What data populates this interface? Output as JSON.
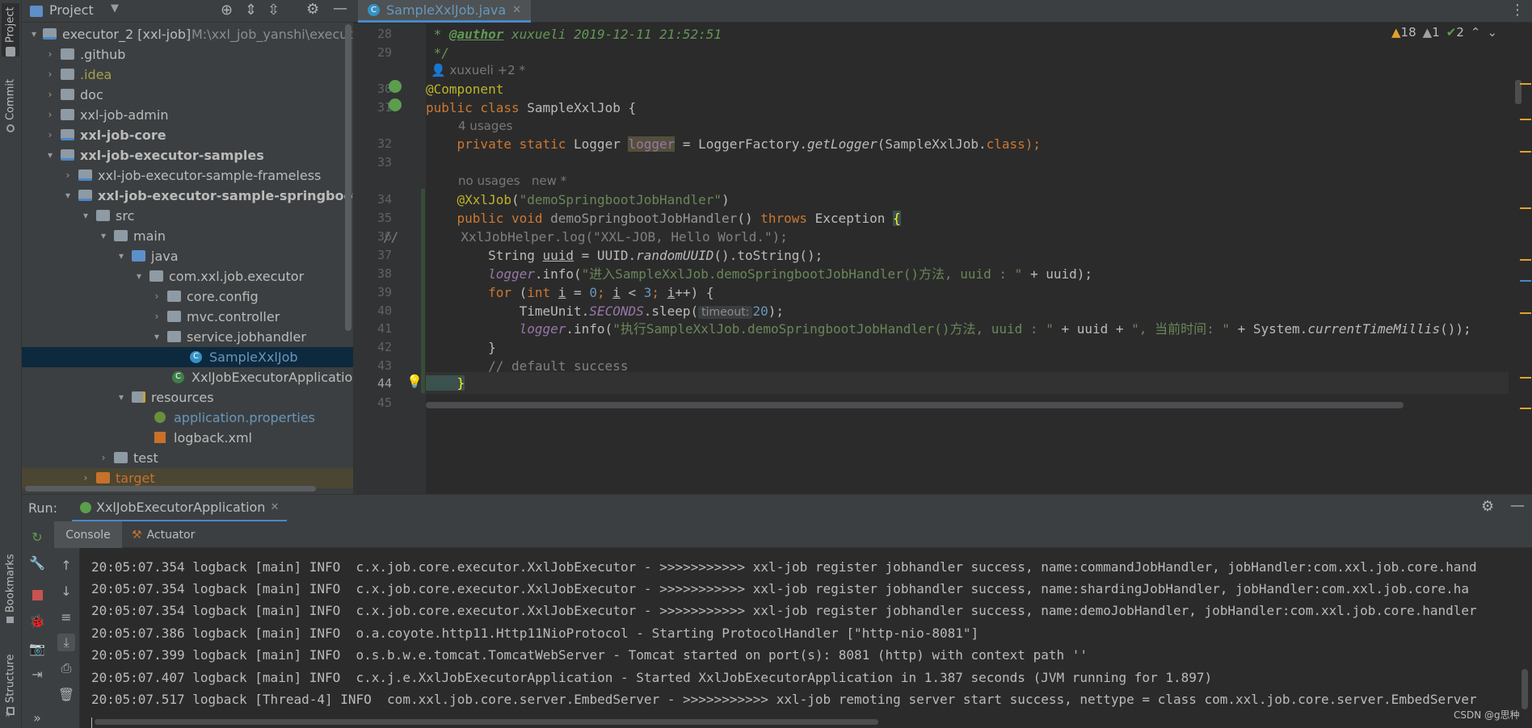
{
  "left_strip": {
    "project": "Project",
    "commit": "Commit",
    "bookmarks": "Bookmarks",
    "structure": "Structure"
  },
  "project_panel": {
    "title": "Project",
    "tree": [
      {
        "label": "executor_2 [xxl-job]",
        "path": "M:\\xxl_job_yanshi\\executor"
      },
      {
        "label": ".github"
      },
      {
        "label": ".idea"
      },
      {
        "label": "doc"
      },
      {
        "label": "xxl-job-admin"
      },
      {
        "label": "xxl-job-core"
      },
      {
        "label": "xxl-job-executor-samples"
      },
      {
        "label": "xxl-job-executor-sample-frameless"
      },
      {
        "label": "xxl-job-executor-sample-springboot"
      },
      {
        "label": "src"
      },
      {
        "label": "main"
      },
      {
        "label": "java"
      },
      {
        "label": "com.xxl.job.executor"
      },
      {
        "label": "core.config"
      },
      {
        "label": "mvc.controller"
      },
      {
        "label": "service.jobhandler"
      },
      {
        "label": "SampleXxlJob"
      },
      {
        "label": "XxlJobExecutorApplication"
      },
      {
        "label": "resources"
      },
      {
        "label": "application.properties"
      },
      {
        "label": "logback.xml"
      },
      {
        "label": "test"
      },
      {
        "label": "target"
      }
    ]
  },
  "editor": {
    "tab_label": "SampleXxlJob.java",
    "inspections": {
      "warn": "18",
      "weak": "1",
      "ok": "2"
    },
    "line_numbers": [
      "28",
      "29",
      "",
      "30",
      "31",
      "",
      "32",
      "33",
      "",
      "34",
      "35",
      "36",
      "37",
      "38",
      "39",
      "40",
      "41",
      "42",
      "43",
      "44",
      "45"
    ],
    "author_hint": "xuxueli +2 *",
    "usages1": "4 usages",
    "usages2a": "no usages",
    "usages2b": "new *",
    "param_hint": "timeout:",
    "code": {
      "l28_a": " * ",
      "l28_tag": "@author",
      "l28_b": " xuxueli 2019-12-11 21:52:51",
      "l29": " */",
      "l30": "@Component",
      "l31_kw": "public class ",
      "l31_rest": "SampleXxlJob {",
      "l32_kw": "    private static ",
      "l32_t": "Logger ",
      "l32_f": "logger",
      "l32_m": " = LoggerFactory.",
      "l32_i": "getLogger",
      "l32_e": "(SampleXxlJob.",
      "l32_c": "class",
      "l32_z": ");",
      "l34_an": "    @XxlJob",
      "l34_p": "(",
      "l34_s": "\"demoSpringbootJobHandler\"",
      "l34_z": ")",
      "l35_kw": "    public void ",
      "l35_n": "demoSpringbootJobHandler",
      "l35_m": "() ",
      "l35_th": "throws ",
      "l35_ex": "Exception ",
      "l35_b": "{",
      "l36": "//        XxlJobHelper.log(\"XXL-JOB, Hello World.\");",
      "l37_a": "        String ",
      "l37_v": "uuid",
      "l37_b": " = UUID.",
      "l37_i": "randomUUID",
      "l37_c": "().toString();",
      "l38_f": "        logger",
      "l38_a": ".info(",
      "l38_s": "\"进入SampleXxlJob.demoSpringbootJobHandler()方法, uuid : \"",
      "l38_b": " + uuid);",
      "l39_kw": "        for ",
      "l39_a": "(",
      "l39_int": "int ",
      "l39_i": "i",
      "l39_b": " = ",
      "l39_n0": "0",
      "l39_c": "; ",
      "l39_i2": "i",
      "l39_d": " < ",
      "l39_n3": "3",
      "l39_e": "; ",
      "l39_i3": "i",
      "l39_f": "++) {",
      "l40_a": "            TimeUnit.",
      "l40_f": "SECONDS",
      "l40_b": ".sleep(",
      "l40_n": "20",
      "l40_c": ");",
      "l41_f": "            logger",
      "l41_a": ".info(",
      "l41_s": "\"执行SampleXxlJob.demoSpringbootJobHandler()方法, uuid : \"",
      "l41_b": " + uuid + ",
      "l41_s2": "\", 当前时间: \"",
      "l41_c": " + System.",
      "l41_i": "currentTimeMillis",
      "l41_d": "());",
      "l42": "        }",
      "l43": "        // default success",
      "l44": "    }"
    }
  },
  "run": {
    "label": "Run:",
    "app": "XxlJobExecutorApplication",
    "tabs": {
      "console": "Console",
      "actuator": "Actuator"
    },
    "log": [
      "20:05:07.354 logback [main] INFO  c.x.job.core.executor.XxlJobExecutor - >>>>>>>>>>> xxl-job register jobhandler success, name:commandJobHandler, jobHandler:com.xxl.job.core.hand",
      "20:05:07.354 logback [main] INFO  c.x.job.core.executor.XxlJobExecutor - >>>>>>>>>>> xxl-job register jobhandler success, name:shardingJobHandler, jobHandler:com.xxl.job.core.ha",
      "20:05:07.354 logback [main] INFO  c.x.job.core.executor.XxlJobExecutor - >>>>>>>>>>> xxl-job register jobhandler success, name:demoJobHandler, jobHandler:com.xxl.job.core.handler",
      "20:05:07.386 logback [main] INFO  o.a.coyote.http11.Http11NioProtocol - Starting ProtocolHandler [\"http-nio-8081\"]",
      "20:05:07.399 logback [main] INFO  o.s.b.w.e.tomcat.TomcatWebServer - Tomcat started on port(s): 8081 (http) with context path ''",
      "20:05:07.407 logback [main] INFO  c.x.j.e.XxlJobExecutorApplication - Started XxlJobExecutorApplication in 1.387 seconds (JVM running for 1.897)",
      "20:05:07.517 logback [Thread-4] INFO  com.xxl.job.core.server.EmbedServer - >>>>>>>>>>> xxl-job remoting server start success, nettype = class com.xxl.job.core.server.EmbedServer"
    ],
    "watermark": "CSDN @g思种"
  },
  "colors": {
    "accent": "#4a88c7",
    "selection": "#0d293e",
    "bg": "#2b2b2b",
    "panel": "#3c3f41"
  }
}
